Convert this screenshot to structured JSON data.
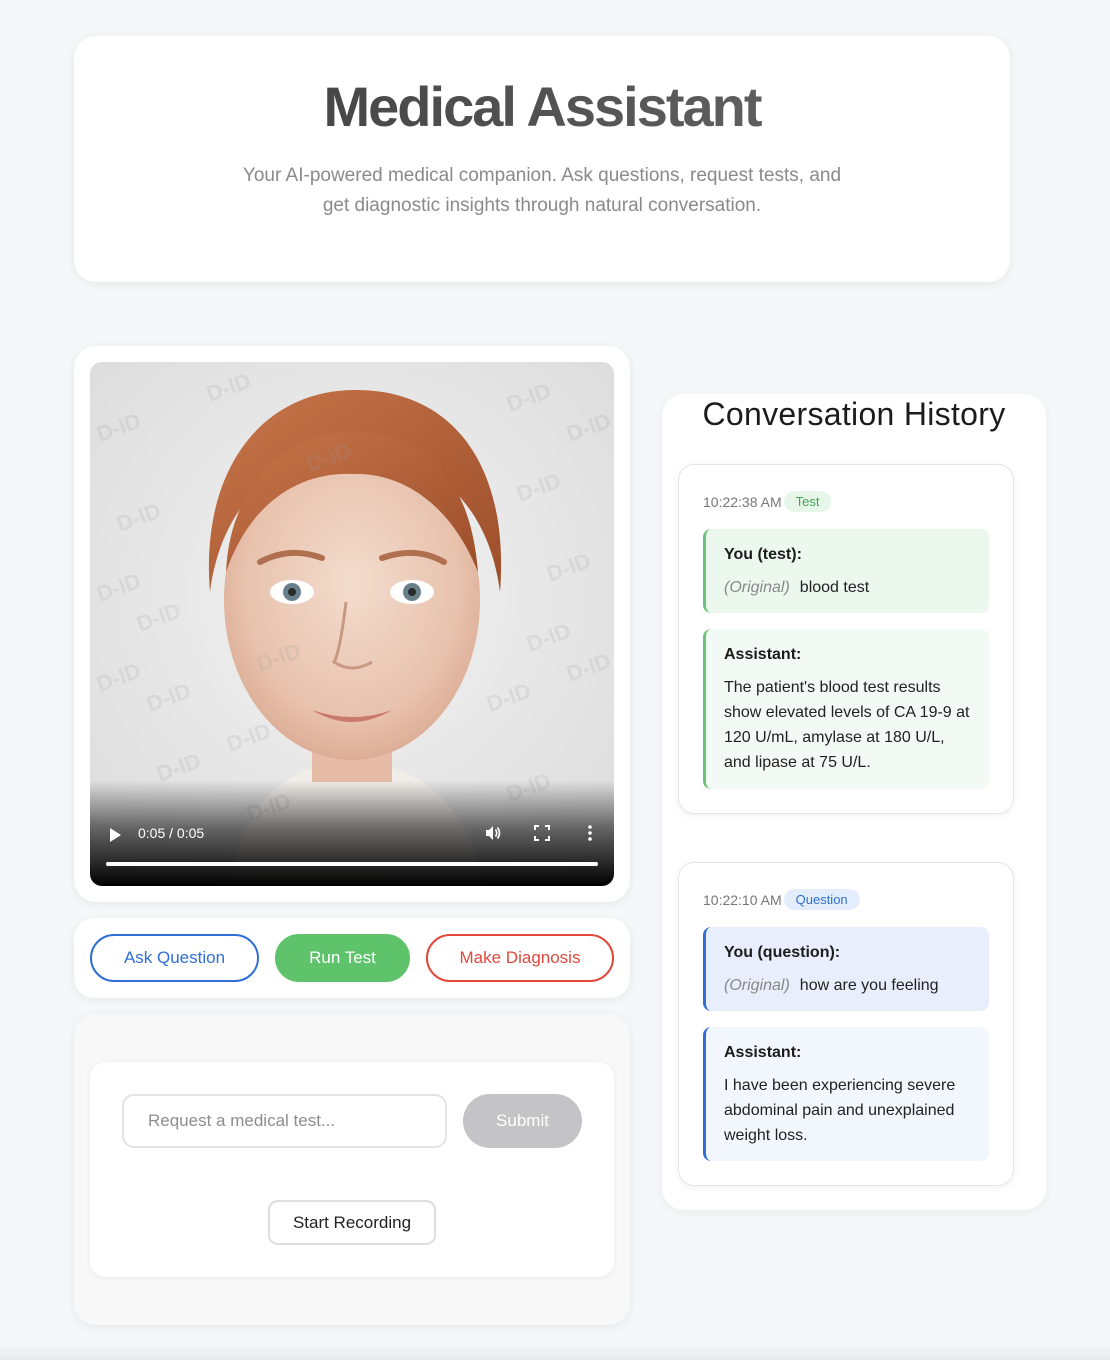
{
  "header": {
    "title": "Medical Assistant",
    "subtitle": "Your AI-powered medical companion. Ask questions, request tests, and get diagnostic insights through natural conversation."
  },
  "video": {
    "time": "0:05 / 0:05",
    "progress_fraction": 1.0,
    "watermark": "D-ID"
  },
  "modes": {
    "ask": "Ask Question",
    "test": "Run Test",
    "diagnosis": "Make Diagnosis",
    "active": "test",
    "colors": {
      "ask": "#2f6fd6",
      "test": "#5ec36a",
      "diagnosis": "#e0483c"
    }
  },
  "input": {
    "placeholder": "Request a medical test...",
    "value": "",
    "submit": "Submit",
    "record": "Start Recording"
  },
  "history": {
    "title": "Conversation History",
    "entries": [
      {
        "timestamp": "10:22:38 AM",
        "badge": "Test",
        "user_label": "You (test):",
        "original_tag": "(Original)",
        "user_text": "blood test",
        "assistant_label": "Assistant:",
        "assistant_text": "The patient's blood test results show elevated levels of CA 19-9 at 120 U/mL, amylase at 180 U/L, and lipase at 75 U/L."
      },
      {
        "timestamp": "10:22:10 AM",
        "badge": "Question",
        "user_label": "You (question):",
        "original_tag": "(Original)",
        "user_text": "how are you feeling",
        "assistant_label": "Assistant:",
        "assistant_text": "I have been experiencing severe abdominal pain and unexplained weight loss."
      }
    ]
  }
}
